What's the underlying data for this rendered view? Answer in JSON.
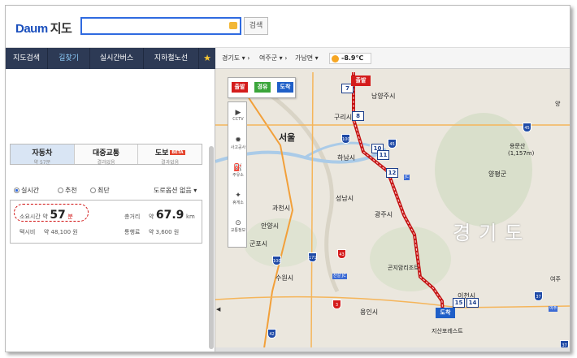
{
  "header": {
    "logo_en": "Daum",
    "logo_kr": "지도",
    "search_value": "",
    "search_button": "검색"
  },
  "nav": {
    "tabs": [
      "지도검색",
      "길찾기",
      "실시간버스",
      "지하철노선"
    ],
    "active": 1,
    "star": "★"
  },
  "modes": [
    {
      "name": "자동차",
      "sub": "약 57분",
      "active": true
    },
    {
      "name": "대중교통",
      "sub": "결과없음",
      "active": false
    },
    {
      "name": "도보",
      "sub": "결과없음",
      "badge": "BETA",
      "active": false
    }
  ],
  "options": {
    "realtime": "실시간",
    "recommend": "추천",
    "shortest": "최단",
    "toll_option": "도로옵션 없음"
  },
  "result": {
    "time_label": "소요시간",
    "time_approx": "약",
    "time_value": "57",
    "time_unit": "분",
    "dist_label": "총거리",
    "dist_approx": "약",
    "dist_value": "67.9",
    "dist_unit": "km",
    "taxi_label": "택시비",
    "taxi_value": "약 48,100 원",
    "toll_label": "통행료",
    "toll_value": "약 3,600 원"
  },
  "mapbar": {
    "province": "경기도",
    "county": "여주군",
    "town": "가남면",
    "temp": "-8.9℃"
  },
  "flags": {
    "start": "출발",
    "via": "경유",
    "end": "도착"
  },
  "tools": [
    {
      "name": "cctv",
      "label": "CCTV",
      "glyph": "▶"
    },
    {
      "name": "accident",
      "label": "사고공사",
      "glyph": "✹"
    },
    {
      "name": "gas",
      "label": "주유소",
      "glyph": "⛽"
    },
    {
      "name": "rest",
      "label": "휴게소",
      "glyph": "✦"
    },
    {
      "name": "traffic",
      "label": "교통정보",
      "glyph": "⊙"
    }
  ],
  "map_labels": {
    "namyangju": "남양주시",
    "guri": "구리시",
    "seoul": "서울",
    "hanam": "하남시",
    "seongnam": "성남시",
    "gwacheon": "과천시",
    "anyang": "안양시",
    "gunpo": "군포시",
    "suwon": "수원시",
    "yongin": "용인시",
    "gwangju": "광주시",
    "icheon": "이천시",
    "gonjiam": "곤지암리조트",
    "yangpyeong": "양평군",
    "yongmunsan": "용문산",
    "yongmunsan_h": "(1,157m)",
    "gyeonggi": "경기도",
    "sanjeok": "지산포레스트",
    "sinbuk_jc": "산갈 JC",
    "jc": "JC",
    "yeoju": "여주",
    "yeoju2": "여주",
    "yang": "양"
  },
  "signs": [
    "7",
    "8",
    "10",
    "11",
    "12",
    "15",
    "14"
  ],
  "pins": {
    "start": "출발",
    "end": "도착"
  },
  "shields": [
    "100",
    "171",
    "100",
    "43",
    "3",
    "42",
    "45",
    "37",
    "45",
    "37"
  ]
}
